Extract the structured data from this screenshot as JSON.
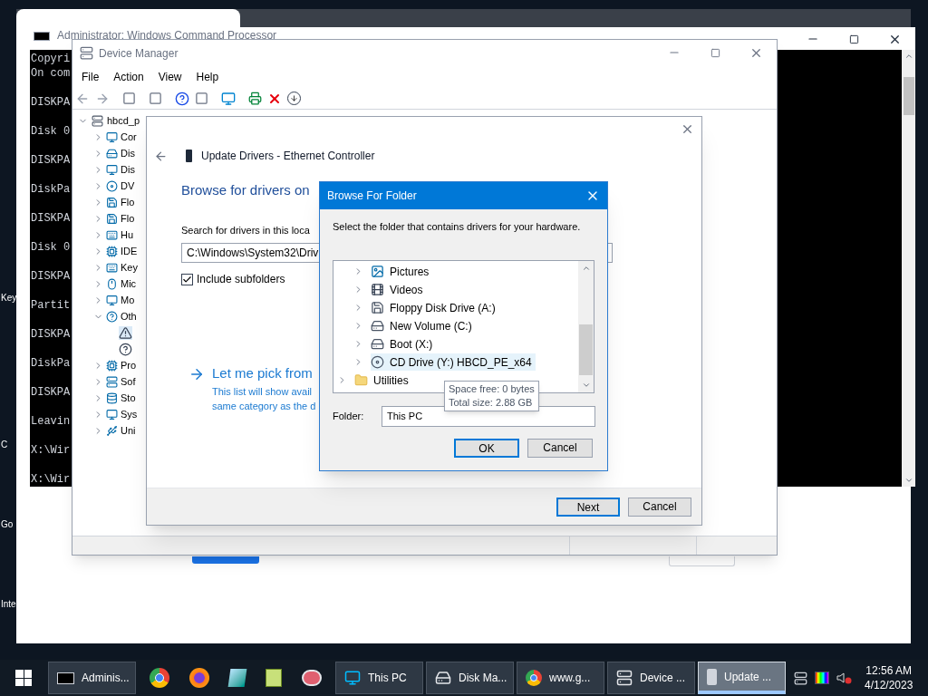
{
  "desktop": {
    "icon_labels": [
      "Key",
      "C",
      "Go",
      "Inte"
    ]
  },
  "command_window": {
    "title": "Administrator: Windows Command Processor",
    "lines": [
      "Copyri",
      "On com",
      "DISKPA",
      "Disk 0",
      "DISKPA",
      "DiskPa",
      "DISKPA",
      "Disk 0",
      "DISKPA",
      "Partit",
      "DISKPA",
      "DiskPa",
      "DISKPA",
      "Leavin",
      "X:\\Wir",
      "X:\\Wir"
    ]
  },
  "device_manager": {
    "title": "Device Manager",
    "menu": [
      "File",
      "Action",
      "View",
      "Help"
    ],
    "tree": {
      "label": "hbcd_p",
      "expanded": true,
      "children": [
        {
          "label": "Cor",
          "expanded": false
        },
        {
          "label": "Dis",
          "expanded": false
        },
        {
          "label": "Dis",
          "expanded": false
        },
        {
          "label": "DV",
          "expanded": false
        },
        {
          "label": "Flo",
          "expanded": false
        },
        {
          "label": "Flo",
          "expanded": false
        },
        {
          "label": "Hu",
          "expanded": false
        },
        {
          "label": "IDE",
          "expanded": false
        },
        {
          "label": "Key",
          "expanded": false
        },
        {
          "label": "Mic",
          "expanded": false
        },
        {
          "label": "Mo",
          "expanded": false
        },
        {
          "label": "Oth",
          "expanded": true,
          "children": [
            {
              "kind": "warning"
            },
            {
              "kind": "unknown"
            }
          ]
        },
        {
          "label": "Pro",
          "expanded": false
        },
        {
          "label": "Sof",
          "expanded": false
        },
        {
          "label": "Sto",
          "expanded": false
        },
        {
          "label": "Sys",
          "expanded": false
        },
        {
          "label": "Uni",
          "expanded": false
        }
      ]
    }
  },
  "update_drivers": {
    "title": "Update Drivers - Ethernet Controller",
    "heading": "Browse for drivers on",
    "search_label": "Search for drivers in this loca",
    "path": "C:\\Windows\\System32\\Driv",
    "include_subfolders": {
      "label": "Include subfolders",
      "checked": true
    },
    "pick_link": {
      "title": "Let me pick from",
      "description": [
        "This list will show avail",
        "same category as the d"
      ]
    },
    "buttons": [
      {
        "label": "Next",
        "default": true
      },
      {
        "label": "Cancel",
        "default": false
      }
    ]
  },
  "browse_folder": {
    "title": "Browse For Folder",
    "prompt": "Select the folder that contains drivers for your hardware.",
    "tree": [
      {
        "children": [
          {
            "label": "Pictures",
            "kind": "pictures",
            "expanded": false,
            "highlighted": false
          },
          {
            "label": "Videos",
            "kind": "videos",
            "expanded": false,
            "highlighted": false
          },
          {
            "label": "Floppy Disk Drive (A:)",
            "kind": "floppy",
            "expanded": false,
            "highlighted": false
          },
          {
            "label": "New Volume (C:)",
            "kind": "drive",
            "expanded": false,
            "highlighted": false
          },
          {
            "label": "Boot (X:)",
            "kind": "drive",
            "expanded": false,
            "highlighted": false
          },
          {
            "label": "CD Drive (Y:) HBCD_PE_x64",
            "kind": "cd",
            "expanded": false,
            "highlighted": true
          }
        ]
      },
      {
        "label": "Utilities",
        "kind": "folder",
        "expanded": false,
        "highlighted": false
      }
    ],
    "tooltip": [
      "Space free: 0 bytes",
      "Total size: 2.88 GB"
    ],
    "folder_label": "Folder:",
    "folder_value": "This PC",
    "buttons": [
      {
        "label": "OK",
        "default": true
      },
      {
        "label": "Cancel",
        "default": false
      }
    ]
  },
  "taskbar": {
    "windows": [
      {
        "label": "Adminis...",
        "selected": false
      },
      {
        "label": "This PC",
        "selected": false
      },
      {
        "label": "Disk Ma...",
        "selected": false
      },
      {
        "label": "www.g...",
        "selected": false
      },
      {
        "label": "Device ...",
        "selected": false
      },
      {
        "label": "Update ...",
        "selected": true
      }
    ],
    "time": "12:56 AM",
    "date": "4/12/2023"
  }
}
